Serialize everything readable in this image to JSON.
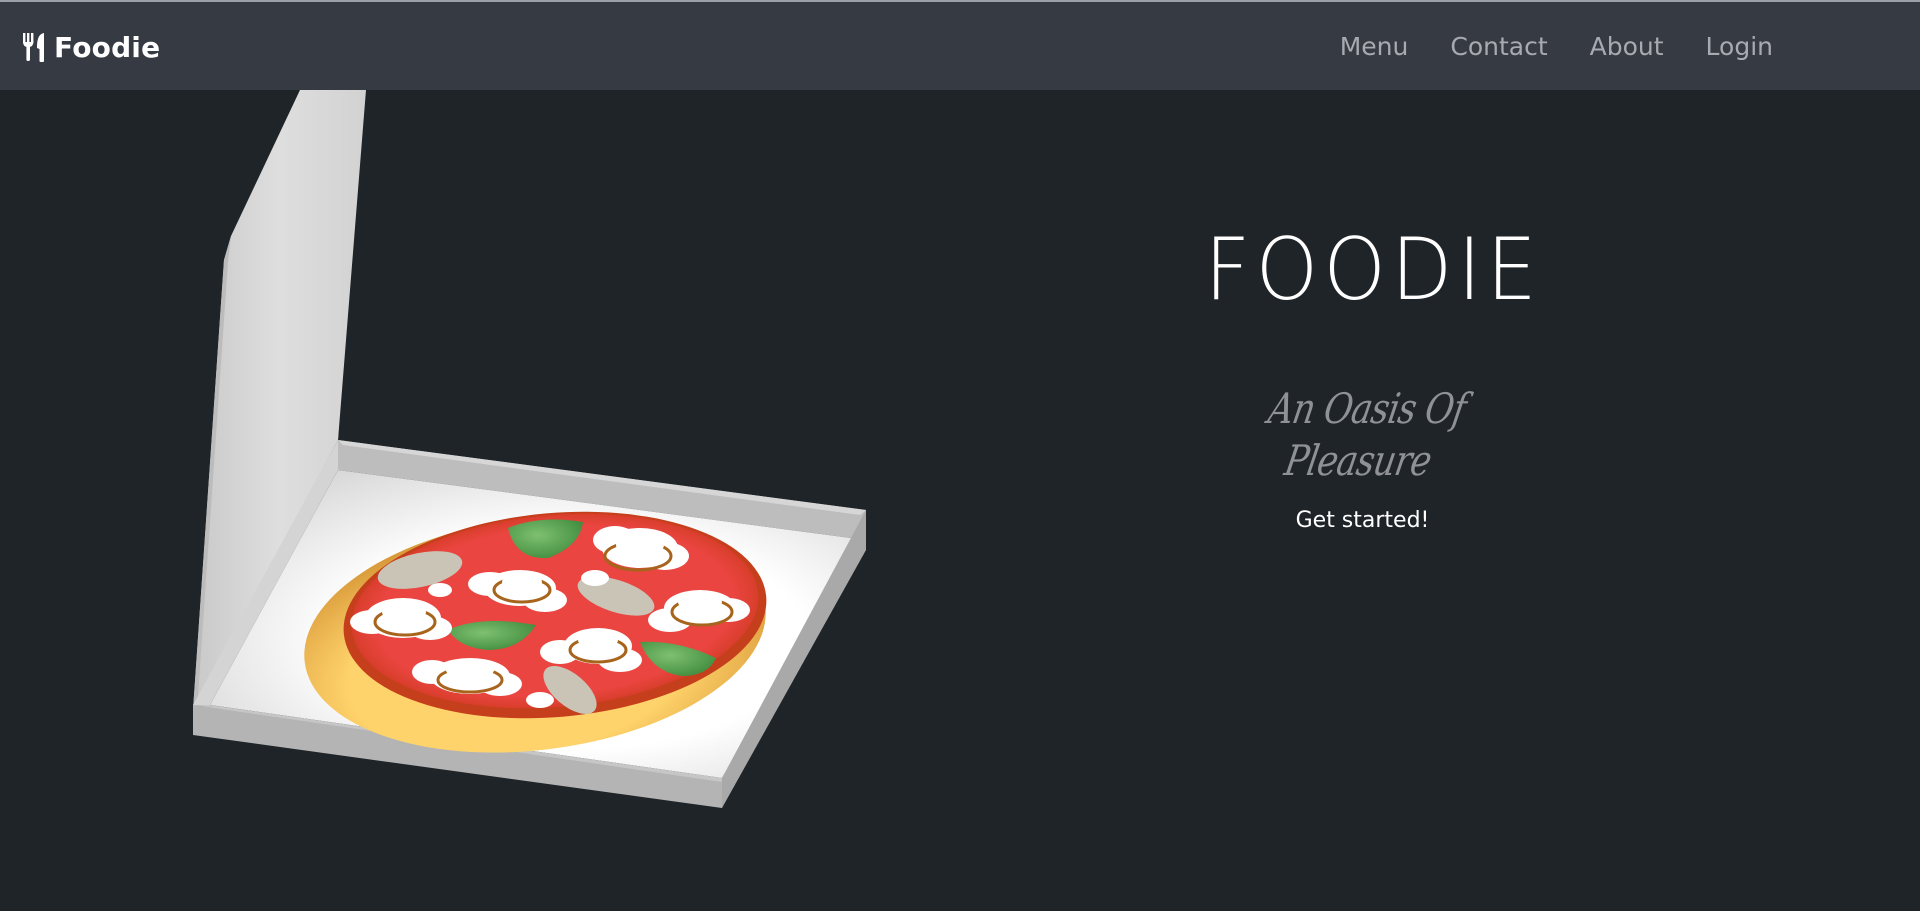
{
  "navbar": {
    "brand": {
      "icon": "utensils-icon",
      "label": "Foodie"
    },
    "links": [
      {
        "label": "Menu"
      },
      {
        "label": "Contact"
      },
      {
        "label": "About"
      },
      {
        "label": "Login"
      }
    ]
  },
  "hero": {
    "title": "FOODIE",
    "tagline": "An Oasis Of Pleasure",
    "cta_label": "Get started!",
    "illustration": "pizza-box-illustration"
  },
  "colors": {
    "page_background": "#1f2428",
    "navbar_background": "#363a43",
    "nav_link": "#a7aab0",
    "tagline": "#8e9196",
    "pizza_sauce": "#e8423e",
    "pizza_crust": "#f5c150",
    "basil": "#4f9a4c"
  }
}
